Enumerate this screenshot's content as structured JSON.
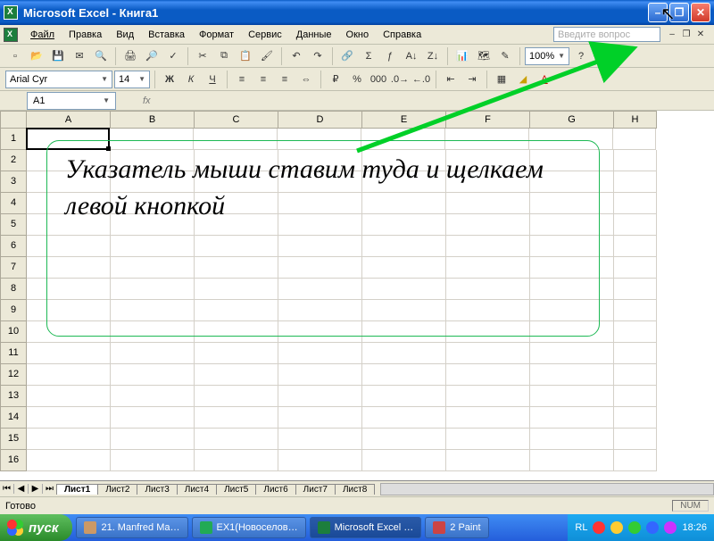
{
  "title": "Microsoft Excel - Книга1",
  "menu": [
    "Файл",
    "Правка",
    "Вид",
    "Вставка",
    "Формат",
    "Сервис",
    "Данные",
    "Окно",
    "Справка"
  ],
  "ask_placeholder": "Введите вопрос",
  "font": {
    "name": "Arial Cyr",
    "size": "14"
  },
  "zoom": "100%",
  "name_box": "A1",
  "columns": [
    "A",
    "B",
    "C",
    "D",
    "E",
    "F",
    "G",
    "H"
  ],
  "rows": [
    "1",
    "2",
    "3",
    "4",
    "5",
    "6",
    "7",
    "8",
    "9",
    "10",
    "11",
    "12",
    "13",
    "14",
    "15",
    "16"
  ],
  "callout_text": "Указатель мыши ставим туда и щелкаем левой кнопкой",
  "sheets": [
    "Лист1",
    "Лист2",
    "Лист3",
    "Лист4",
    "Лист5",
    "Лист6",
    "Лист7",
    "Лист8"
  ],
  "status": "Готово",
  "caps": "NUM",
  "start_label": "пуск",
  "tasks": [
    "21. Manfred Ma…",
    "EX1(Новоселов…",
    "Microsoft Excel …",
    "2 Paint"
  ],
  "lang": "RL",
  "clock": "18:26"
}
